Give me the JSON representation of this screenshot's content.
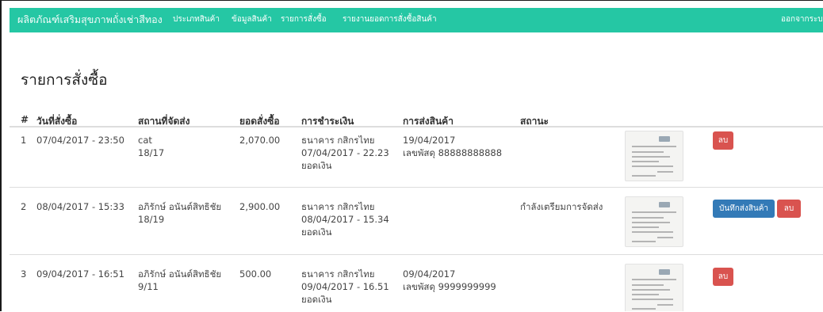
{
  "navbar": {
    "brand": "ผลิตภัณฑ์เสริมสุขภาพถั่งเช่าสีทอง",
    "links": [
      "ประเภทสินค้า",
      "ข้อมูลสินค้า",
      "รายการสั่งซื้อ",
      "รายงานยอดการสั่งซื้อสินค้า"
    ],
    "logout": "ออกจากระบ"
  },
  "page": {
    "title": "รายการสั่งซื้อ"
  },
  "table": {
    "headers": [
      "#",
      "วันที่สั่งซื้อ",
      "สถานที่จัดส่ง",
      "ยอดสั่งซื้อ",
      "การชำระเงิน",
      "การส่งสินค้า",
      "สถานะ"
    ],
    "rows": [
      {
        "no": "1",
        "date": "07/04/2017 - 23:50",
        "address": [
          "cat",
          "18/17"
        ],
        "total": "2,070.00",
        "payment": [
          "ธนาคาร กสิกรไทย",
          "07/04/2017 - 22.23",
          "ยอดเงิน"
        ],
        "shipping": [
          "19/04/2017",
          "เลขพัสดุ 88888888888"
        ],
        "status": "",
        "buttons": [
          "ลบ"
        ]
      },
      {
        "no": "2",
        "date": "08/04/2017 - 15:33",
        "address": [
          "อภิรักษ์ อนันต์สิทธิชัย",
          "18/19"
        ],
        "total": "2,900.00",
        "payment": [
          "ธนาคาร กสิกรไทย",
          "08/04/2017 - 15.34",
          "ยอดเงิน"
        ],
        "shipping": [
          "",
          ""
        ],
        "status": "กำลังเตรียมการจัดส่ง",
        "buttons": [
          "บันทึกส่งสินค้า",
          "ลบ"
        ]
      },
      {
        "no": "3",
        "date": "09/04/2017 - 16:51",
        "address": [
          "อภิรักษ์ อนันต์สิทธิชัย",
          "9/11"
        ],
        "total": "500.00",
        "payment": [
          "ธนาคาร กสิกรไทย",
          "09/04/2017 - 16.51",
          "ยอดเงิน"
        ],
        "shipping": [
          "09/04/2017",
          "เลขพัสดุ 9999999999"
        ],
        "status": "",
        "buttons": [
          "ลบ"
        ]
      }
    ]
  },
  "colors": {
    "navbar": "#25c7a4",
    "danger": "#d9534f",
    "primary": "#337ab7"
  }
}
